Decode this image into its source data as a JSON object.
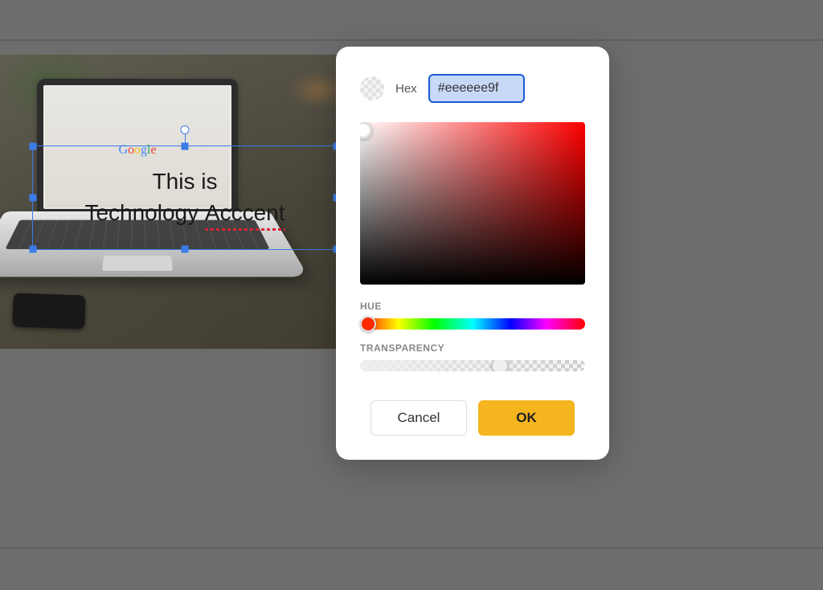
{
  "canvas": {
    "text_line_1": "This is",
    "text_line_2_part_1": "Technology ",
    "text_line_2_misspelled": "Acccent",
    "embedded_logo": "Google"
  },
  "color_picker": {
    "hex_label": "Hex",
    "hex_value": "#eeeeee9f",
    "hue_label": "HUE",
    "transparency_label": "TRANSPARENCY",
    "hue_position_percent": 0,
    "alpha_position_percent": 62,
    "buttons": {
      "cancel_label": "Cancel",
      "ok_label": "OK"
    }
  }
}
